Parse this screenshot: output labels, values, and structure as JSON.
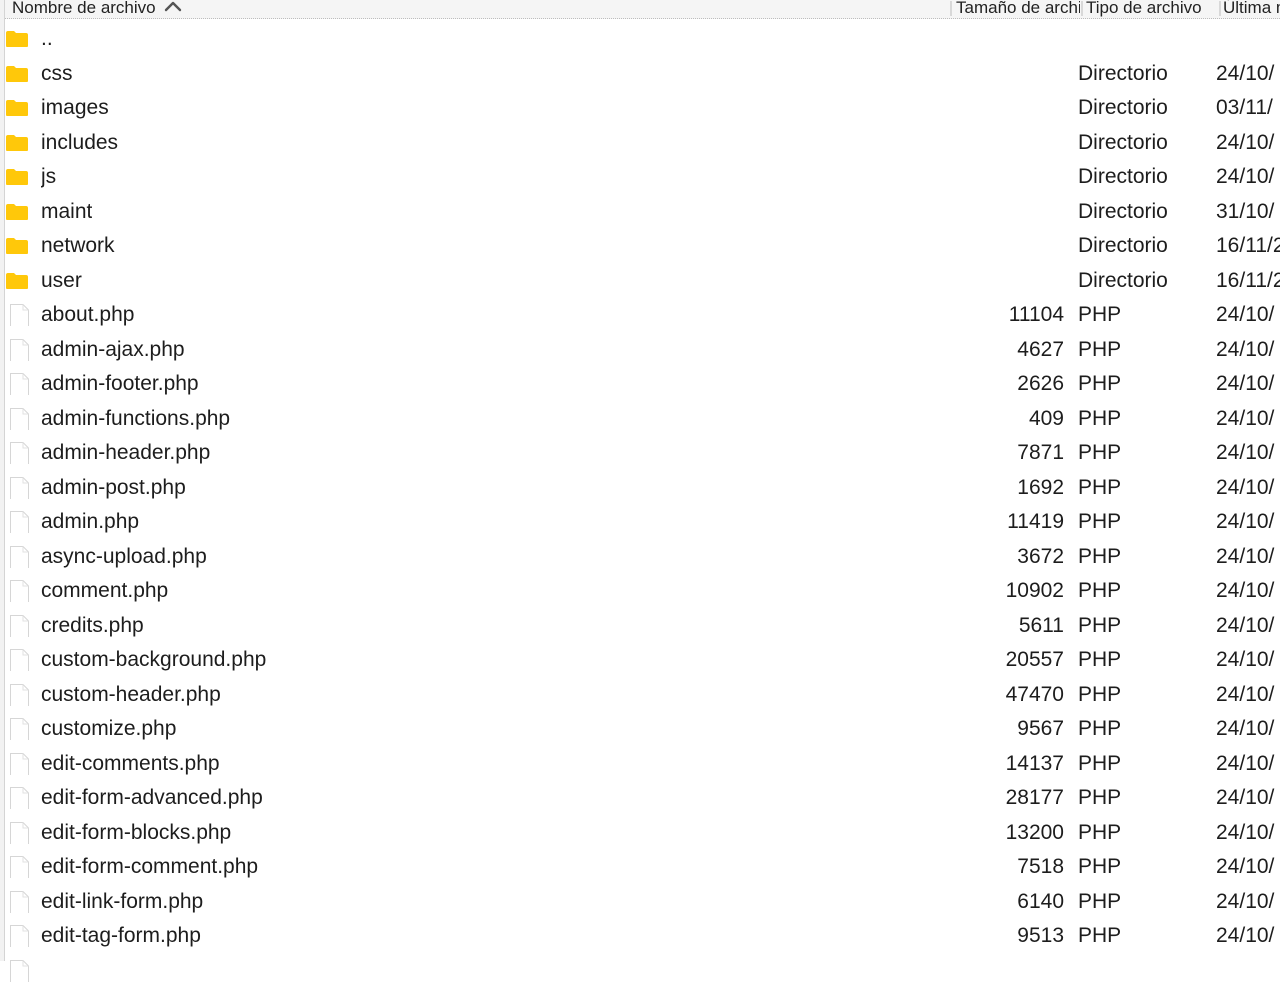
{
  "colors": {
    "folder": "#FFC80A",
    "header_bg": "#F5F5F5",
    "text": "#1D1D1D"
  },
  "header": {
    "columns": [
      {
        "label": "Nombre de archivo",
        "sorted": "ascending",
        "icon": "chevron-up-icon"
      },
      {
        "label": "Tamaño de archivo"
      },
      {
        "label": "Tipo de archivo"
      },
      {
        "label": "Última modificación"
      }
    ]
  },
  "rows": [
    {
      "kind": "folder",
      "icon": "folder-icon",
      "name": "..",
      "size": "",
      "type": "",
      "date": ""
    },
    {
      "kind": "folder",
      "icon": "folder-icon",
      "name": "css",
      "size": "",
      "type": "Directorio",
      "date": "24/10/"
    },
    {
      "kind": "folder",
      "icon": "folder-icon",
      "name": "images",
      "size": "",
      "type": "Directorio",
      "date": "03/11/"
    },
    {
      "kind": "folder",
      "icon": "folder-icon",
      "name": "includes",
      "size": "",
      "type": "Directorio",
      "date": "24/10/"
    },
    {
      "kind": "folder",
      "icon": "folder-icon",
      "name": "js",
      "size": "",
      "type": "Directorio",
      "date": "24/10/"
    },
    {
      "kind": "folder",
      "icon": "folder-icon",
      "name": "maint",
      "size": "",
      "type": "Directorio",
      "date": "31/10/"
    },
    {
      "kind": "folder",
      "icon": "folder-icon",
      "name": "network",
      "size": "",
      "type": "Directorio",
      "date": "16/11/2"
    },
    {
      "kind": "folder",
      "icon": "folder-icon",
      "name": "user",
      "size": "",
      "type": "Directorio",
      "date": "16/11/2"
    },
    {
      "kind": "file",
      "icon": "file-icon",
      "name": "about.php",
      "size": "11104",
      "type": "PHP",
      "date": "24/10/"
    },
    {
      "kind": "file",
      "icon": "file-icon",
      "name": "admin-ajax.php",
      "size": "4627",
      "type": "PHP",
      "date": "24/10/"
    },
    {
      "kind": "file",
      "icon": "file-icon",
      "name": "admin-footer.php",
      "size": "2626",
      "type": "PHP",
      "date": "24/10/"
    },
    {
      "kind": "file",
      "icon": "file-icon",
      "name": "admin-functions.php",
      "size": "409",
      "type": "PHP",
      "date": "24/10/"
    },
    {
      "kind": "file",
      "icon": "file-icon",
      "name": "admin-header.php",
      "size": "7871",
      "type": "PHP",
      "date": "24/10/"
    },
    {
      "kind": "file",
      "icon": "file-icon",
      "name": "admin-post.php",
      "size": "1692",
      "type": "PHP",
      "date": "24/10/"
    },
    {
      "kind": "file",
      "icon": "file-icon",
      "name": "admin.php",
      "size": "11419",
      "type": "PHP",
      "date": "24/10/"
    },
    {
      "kind": "file",
      "icon": "file-icon",
      "name": "async-upload.php",
      "size": "3672",
      "type": "PHP",
      "date": "24/10/"
    },
    {
      "kind": "file",
      "icon": "file-icon",
      "name": "comment.php",
      "size": "10902",
      "type": "PHP",
      "date": "24/10/"
    },
    {
      "kind": "file",
      "icon": "file-icon",
      "name": "credits.php",
      "size": "5611",
      "type": "PHP",
      "date": "24/10/"
    },
    {
      "kind": "file",
      "icon": "file-icon",
      "name": "custom-background.php",
      "size": "20557",
      "type": "PHP",
      "date": "24/10/"
    },
    {
      "kind": "file",
      "icon": "file-icon",
      "name": "custom-header.php",
      "size": "47470",
      "type": "PHP",
      "date": "24/10/"
    },
    {
      "kind": "file",
      "icon": "file-icon",
      "name": "customize.php",
      "size": "9567",
      "type": "PHP",
      "date": "24/10/"
    },
    {
      "kind": "file",
      "icon": "file-icon",
      "name": "edit-comments.php",
      "size": "14137",
      "type": "PHP",
      "date": "24/10/"
    },
    {
      "kind": "file",
      "icon": "file-icon",
      "name": "edit-form-advanced.php",
      "size": "28177",
      "type": "PHP",
      "date": "24/10/"
    },
    {
      "kind": "file",
      "icon": "file-icon",
      "name": "edit-form-blocks.php",
      "size": "13200",
      "type": "PHP",
      "date": "24/10/"
    },
    {
      "kind": "file",
      "icon": "file-icon",
      "name": "edit-form-comment.php",
      "size": "7518",
      "type": "PHP",
      "date": "24/10/"
    },
    {
      "kind": "file",
      "icon": "file-icon",
      "name": "edit-link-form.php",
      "size": "6140",
      "type": "PHP",
      "date": "24/10/"
    },
    {
      "kind": "file",
      "icon": "file-icon",
      "name": "edit-tag-form.php",
      "size": "9513",
      "type": "PHP",
      "date": "24/10/"
    },
    {
      "kind": "file",
      "icon": "file-icon",
      "name": "",
      "size": "",
      "type": "",
      "date": ""
    }
  ]
}
